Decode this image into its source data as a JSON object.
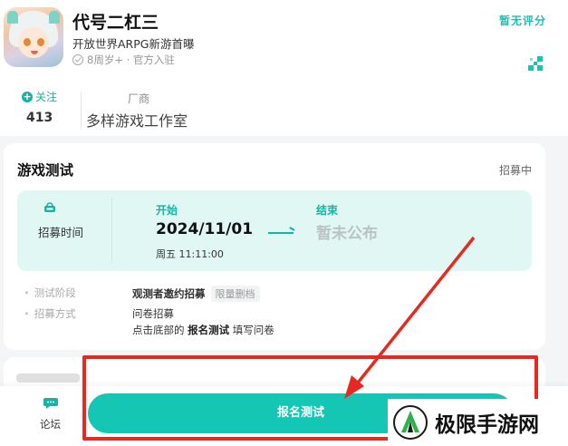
{
  "game": {
    "title": "代号二杠三",
    "subtitle": "开放世界ARPG新游首曝",
    "meta": "8周岁+ · 官方入驻",
    "rating": "暂无评分"
  },
  "stats": {
    "follow_label": "关注",
    "follow_count": "413",
    "maker_label": "厂商",
    "maker_name": "多样游戏工作室"
  },
  "test_card": {
    "title": "游戏测试",
    "status": "招募中",
    "recruit_time_label": "招募时间",
    "start_label": "开始",
    "start_date": "2024/11/01",
    "start_time": "周五 11:11:00",
    "end_label": "结束",
    "end_value": "暂未公布",
    "stage_label": "测试阶段",
    "stage_value": "观测者邀约招募",
    "stage_tag": "限量删档",
    "method_label": "招募方式",
    "method_line1": "问卷招募",
    "method_line2_prefix": "点击底部的 ",
    "method_line2_bold": "报名测试",
    "method_line2_suffix": " 填写问卷"
  },
  "bottom_bar": {
    "forum_label": "论坛",
    "signup_label": "报名测试"
  },
  "watermark": {
    "text": "极限手游网"
  },
  "colors": {
    "accent": "#16c6b4",
    "highlight": "#e52a22",
    "recruit_bg": "#e1f7f4"
  }
}
